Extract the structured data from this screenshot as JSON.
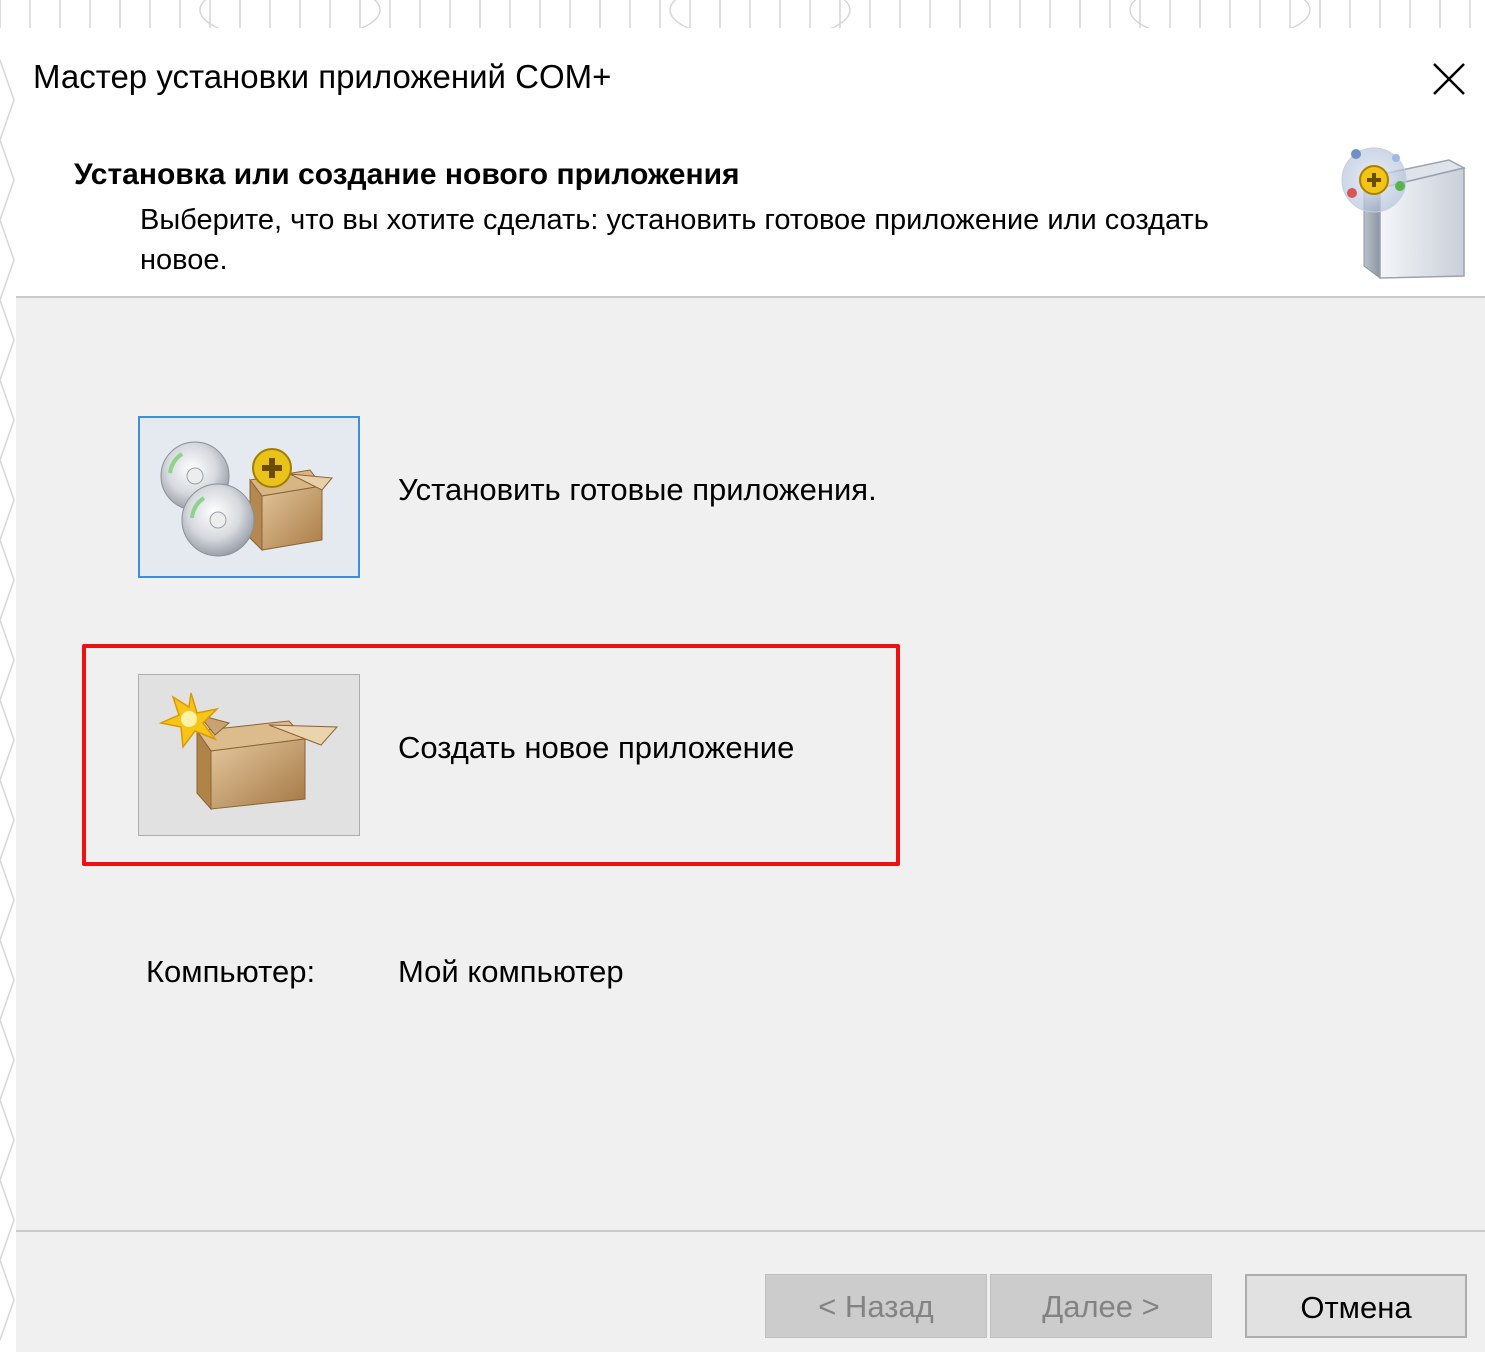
{
  "window": {
    "title": "Мастер установки приложений COM+"
  },
  "header": {
    "title": "Установка или создание нового приложения",
    "subtitle": "Выберите, что вы хотите сделать: установить готовое приложение или создать новое.",
    "icon": "com-plus-wizard-icon"
  },
  "options": [
    {
      "label": "Установить готовые приложения.",
      "icon": "install-discs-box-icon",
      "focused": true
    },
    {
      "label": "Создать новое приложение",
      "icon": "new-box-star-icon",
      "highlighted": true
    }
  ],
  "computer": {
    "label": "Компьютер:",
    "value": "Мой компьютер"
  },
  "buttons": {
    "back": "< Назад",
    "next": "Далее >",
    "cancel": "Отмена"
  },
  "colors": {
    "body_bg": "#f0f0f0",
    "focus_border": "#3c8fd8",
    "highlight_border": "#ee1111",
    "disabled_text": "#838383"
  }
}
